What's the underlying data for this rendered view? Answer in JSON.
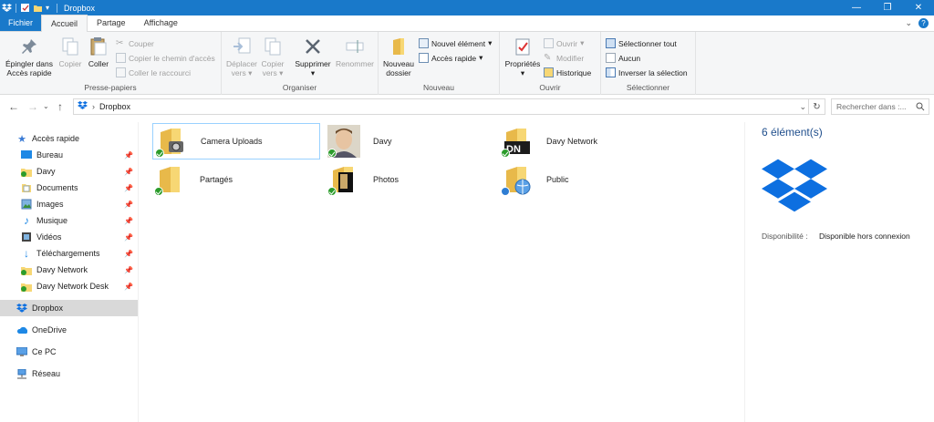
{
  "window": {
    "title": "Dropbox"
  },
  "tabs": {
    "file": "Fichier",
    "home": "Accueil",
    "share": "Partage",
    "view": "Affichage"
  },
  "ribbon": {
    "clipboard": {
      "label": "Presse-papiers",
      "pin": "Épingler dans Accès rapide",
      "pin_line1": "Épingler dans",
      "pin_line2": "Accès rapide",
      "copy": "Copier",
      "paste": "Coller",
      "cut": "Couper",
      "copy_path": "Copier le chemin d'accès",
      "paste_shortcut": "Coller le raccourci"
    },
    "organize": {
      "label": "Organiser",
      "move_line1": "Déplacer",
      "move_line2": "vers",
      "copyto_line1": "Copier",
      "copyto_line2": "vers",
      "delete": "Supprimer",
      "rename": "Renommer"
    },
    "new": {
      "label": "Nouveau",
      "folder_line1": "Nouveau",
      "folder_line2": "dossier",
      "new_item": "Nouvel élément",
      "easy_access": "Accès rapide"
    },
    "open": {
      "label": "Ouvrir",
      "properties": "Propriétés",
      "open": "Ouvrir",
      "edit": "Modifier",
      "history": "Historique"
    },
    "select": {
      "label": "Sélectionner",
      "select_all": "Sélectionner tout",
      "select_none": "Aucun",
      "invert": "Inverser la sélection"
    }
  },
  "address": {
    "path": "Dropbox",
    "search_placeholder": "Rechercher dans :..."
  },
  "nav": {
    "quick_access": "Accès rapide",
    "pinned": [
      {
        "label": "Bureau"
      },
      {
        "label": "Davy"
      },
      {
        "label": "Documents"
      },
      {
        "label": "Images"
      },
      {
        "label": "Musique"
      },
      {
        "label": "Vidéos"
      },
      {
        "label": "Téléchargements"
      },
      {
        "label": "Davy Network"
      },
      {
        "label": "Davy Network Desk"
      }
    ],
    "dropbox": "Dropbox",
    "onedrive": "OneDrive",
    "this_pc": "Ce PC",
    "network": "Réseau"
  },
  "items": [
    {
      "name": "Camera Uploads"
    },
    {
      "name": "Davy"
    },
    {
      "name": "Davy Network"
    },
    {
      "name": "Partagés"
    },
    {
      "name": "Photos"
    },
    {
      "name": "Public"
    }
  ],
  "details": {
    "count": "6 élément(s)",
    "availability_label": "Disponibilité :",
    "availability_value": "Disponible hors connexion"
  },
  "colors": {
    "accent": "#1979ca",
    "dropbox_blue": "#0d6fe0",
    "folder": "#f7d774",
    "sync_ok": "#2b9c2b"
  }
}
